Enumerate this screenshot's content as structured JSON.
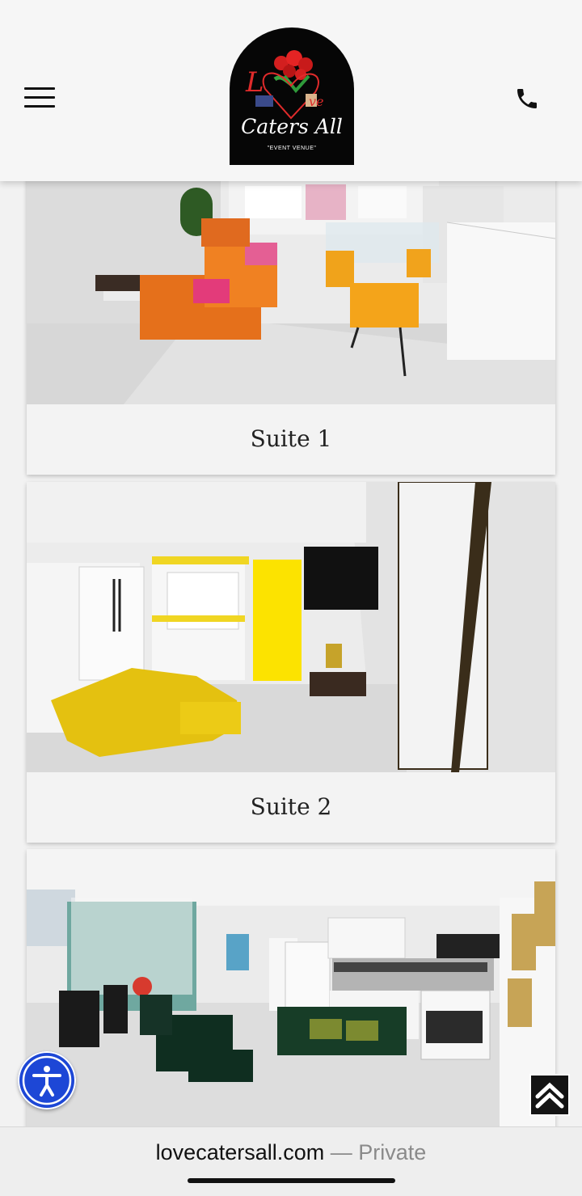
{
  "header": {
    "logo_script": "Caters All",
    "logo_sub": "\"EVENT VENUE\"",
    "logo_love": "L",
    "logo_love2": "ve"
  },
  "icons": {
    "menu": "hamburger-menu-icon",
    "phone": "phone-icon",
    "accessibility": "accessibility-icon",
    "scroll_top": "chevron-up-icon"
  },
  "suites": [
    {
      "title": "Suite 1"
    },
    {
      "title": "Suite 2"
    }
  ],
  "browser": {
    "domain": "lovecatersall.com",
    "separator": "—",
    "status": "Private"
  },
  "colors": {
    "accessibility_blue": "#1d47d6",
    "header_bg": "#f6f6f6"
  }
}
